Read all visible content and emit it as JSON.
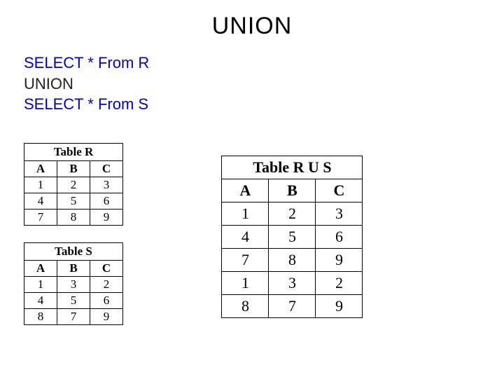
{
  "title": "UNION",
  "sql": {
    "line1": "SELECT * From R",
    "line2": "UNION",
    "line3": "SELECT * From S"
  },
  "tableR": {
    "caption": "Table R",
    "headers": [
      "A",
      "B",
      "C"
    ],
    "rows": [
      [
        "1",
        "2",
        "3"
      ],
      [
        "4",
        "5",
        "6"
      ],
      [
        "7",
        "8",
        "9"
      ]
    ]
  },
  "tableS": {
    "caption": "Table S",
    "headers": [
      "A",
      "B",
      "C"
    ],
    "rows": [
      [
        "1",
        "3",
        "2"
      ],
      [
        "4",
        "5",
        "6"
      ],
      [
        "8",
        "7",
        "9"
      ]
    ]
  },
  "tableRUS": {
    "caption": "Table R U S",
    "headers": [
      "A",
      "B",
      "C"
    ],
    "rows": [
      [
        "1",
        "2",
        "3"
      ],
      [
        "4",
        "5",
        "6"
      ],
      [
        "7",
        "8",
        "9"
      ],
      [
        "1",
        "3",
        "2"
      ],
      [
        "8",
        "7",
        "9"
      ]
    ]
  }
}
